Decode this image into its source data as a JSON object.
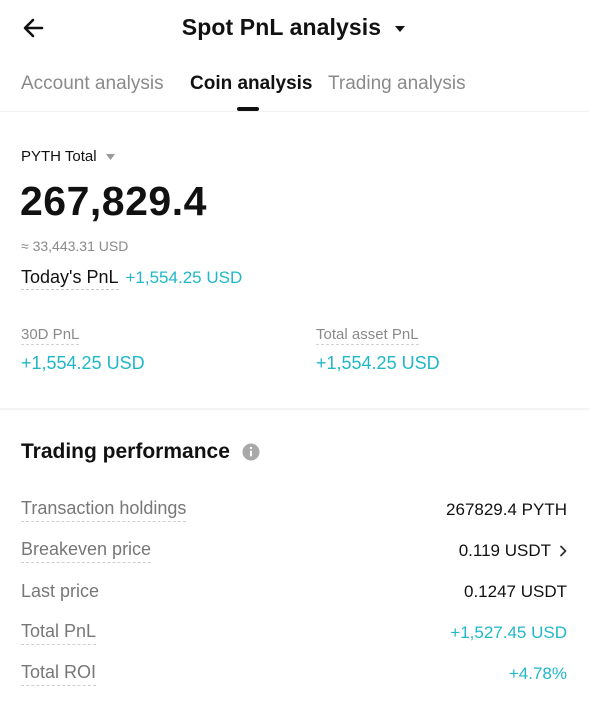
{
  "header": {
    "title": "Spot PnL analysis",
    "back_icon": "arrow-left-icon",
    "dropdown_icon": "caret-down-icon"
  },
  "tabs": [
    {
      "label": "Account analysis",
      "active": false
    },
    {
      "label": "Coin analysis",
      "active": true
    },
    {
      "label": "Trading analysis",
      "active": false
    }
  ],
  "coin": {
    "label": "PYTH Total",
    "total": "267,829.4",
    "usd_approx": "≈ 33,443.31 USD",
    "todays_pnl_label": "Today's PnL",
    "todays_pnl_value": "+1,554.25 USD"
  },
  "stats": {
    "pnl_30d_label": "30D PnL",
    "pnl_30d_value": "+1,554.25 USD",
    "total_asset_pnl_label": "Total asset PnL",
    "total_asset_pnl_value": "+1,554.25 USD"
  },
  "performance": {
    "title": "Trading performance",
    "rows": [
      {
        "label": "Transaction holdings",
        "value": "267829.4 PYTH"
      },
      {
        "label": "Breakeven price",
        "value": "0.119 USDT"
      },
      {
        "label": "Last price",
        "value": "0.1247 USDT"
      },
      {
        "label": "Total PnL",
        "value": "+1,527.45 USD"
      },
      {
        "label": "Total ROI",
        "value": "+4.78%"
      }
    ]
  },
  "colors": {
    "positive": "#20b8c8",
    "text_primary": "#111111",
    "text_secondary": "#8a8a8a"
  }
}
